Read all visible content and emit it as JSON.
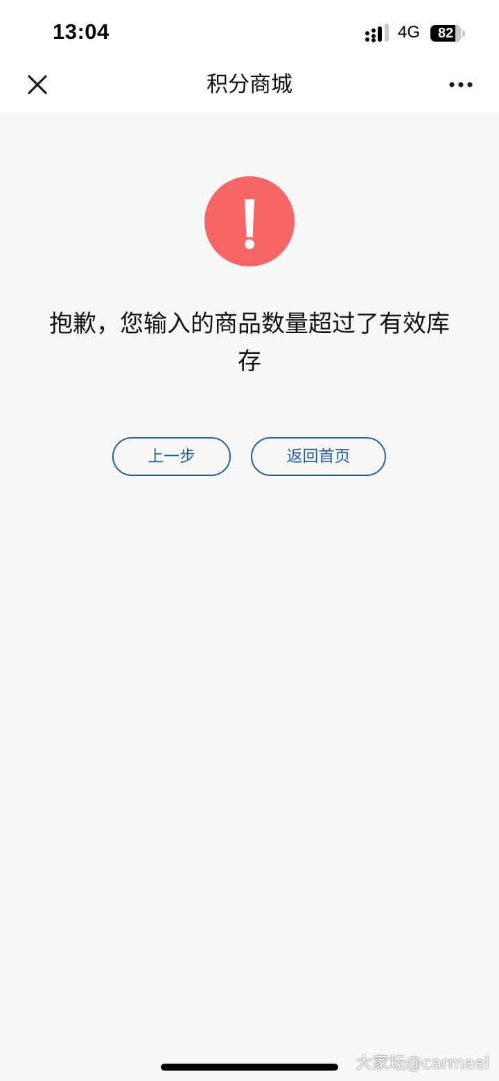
{
  "status_bar": {
    "time": "13:04",
    "network": "4G",
    "battery_level": "82",
    "battery_fraction": 0.82,
    "signal_icon": "cellular-signal-icon",
    "battery_icon": "battery-icon"
  },
  "nav": {
    "title": "积分商城",
    "close_icon": "close-icon",
    "more_icon": "more-dots-icon"
  },
  "error": {
    "icon": "exclamation-circle-icon",
    "icon_color": "#f76566",
    "message": "抱歉，您输入的商品数量超过了有效库存"
  },
  "actions": {
    "prev_label": "上一步",
    "home_label": "返回首页",
    "accent_color": "#1b5fa6"
  },
  "watermark": "大家坛@carmael"
}
